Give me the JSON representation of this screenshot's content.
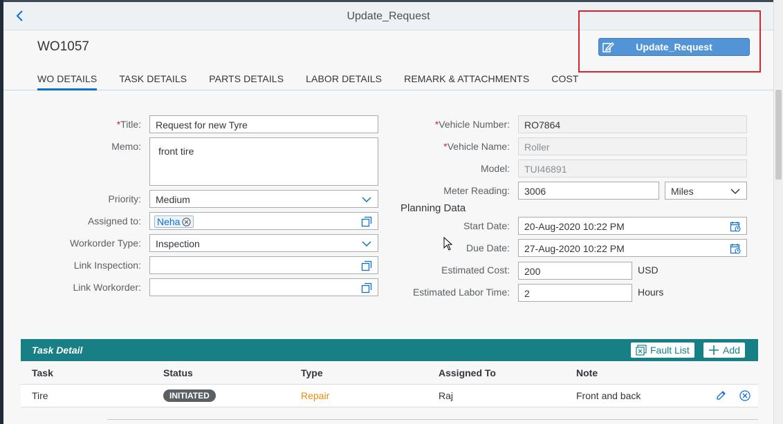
{
  "shell": {
    "title": "Update_Request"
  },
  "header": {
    "object_id": "WO1057",
    "update_button_label": "Update_Request",
    "tabs": [
      {
        "label": "WO DETAILS",
        "active": true
      },
      {
        "label": "TASK DETAILS"
      },
      {
        "label": "PARTS DETAILS"
      },
      {
        "label": "LABOR DETAILS"
      },
      {
        "label": "REMARK & ATTACHMENTS"
      },
      {
        "label": "COST"
      }
    ]
  },
  "form_left": {
    "title_label": "Title:",
    "title_value": "Request for new Tyre",
    "memo_label": "Memo:",
    "memo_value": "front tire",
    "priority_label": "Priority:",
    "priority_value": "Medium",
    "assigned_label": "Assigned to:",
    "assigned_token": "Neha",
    "wo_type_label": "Workorder Type:",
    "wo_type_value": "Inspection",
    "link_inspection_label": "Link Inspection:",
    "link_inspection_value": "",
    "link_workorder_label": "Link Workorder:",
    "link_workorder_value": ""
  },
  "form_right": {
    "vehicle_number_label": "Vehicle Number:",
    "vehicle_number_value": "RO7864",
    "vehicle_name_label": "Vehicle Name:",
    "vehicle_name_value": "Roller",
    "model_label": "Model:",
    "model_value": "TUI46891",
    "meter_label": "Meter Reading:",
    "meter_value": "3006",
    "meter_unit": "Miles",
    "planning_title": "Planning Data",
    "start_label": "Start Date:",
    "start_value": "20-Aug-2020 10:22 PM",
    "due_label": "Due Date:",
    "due_value": "27-Aug-2020 10:22 PM",
    "cost_label": "Estimated Cost:",
    "cost_value": "200",
    "cost_unit": "USD",
    "labor_label": "Estimated Labor Time:",
    "labor_value": "2",
    "labor_unit": "Hours"
  },
  "task_table": {
    "title": "Task Detail",
    "fault_list_label": "Fault List",
    "add_label": "Add",
    "columns": [
      "Task",
      "Status",
      "Type",
      "Assigned To",
      "Note"
    ],
    "rows": [
      {
        "task": "Tire",
        "status": "INITIATED",
        "type": "Repair",
        "assigned_to": "Raj",
        "note": "Front and back"
      }
    ]
  },
  "colors": {
    "accent": "#0a6ed1",
    "table_header": "#168085",
    "highlight": "#d8232a",
    "link_orange": "#e78c07"
  }
}
